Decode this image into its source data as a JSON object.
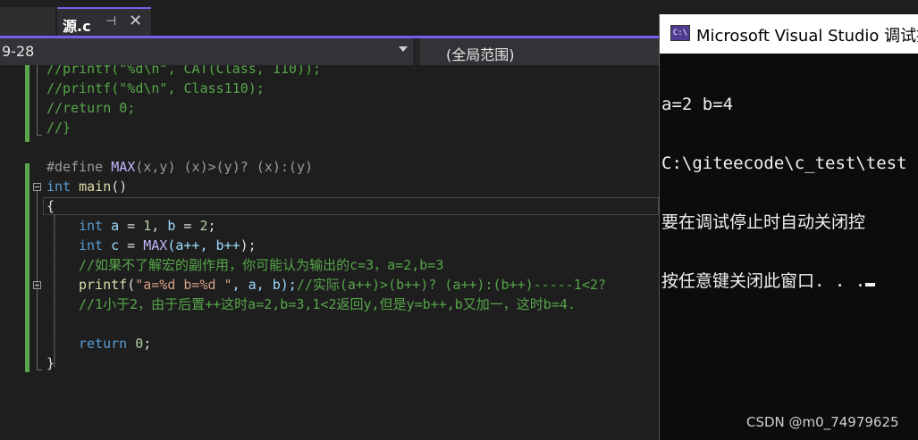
{
  "tab": {
    "title": "源.c",
    "pin": "⊣",
    "close": "✕"
  },
  "nav": {
    "scope_left": "9-28",
    "scope_right": "(全局范围)"
  },
  "code": {
    "l1": "//printf(\"%d\\n\", CAT(Class, 110));",
    "l2": "//printf(\"%d\\n\", Class110);",
    "l3": "//return 0;",
    "l4": "//}",
    "define_kw": "#define",
    "define_name": "MAX",
    "define_params": "(x,y)",
    "define_body": " (x)>(y)? (x):(y)",
    "main_kw": "int",
    "main_name": " main",
    "main_paren": "()",
    "brace_open": "{",
    "a_kw": "int",
    "a_name1": " a",
    "a_eq1": " = ",
    "a_val1": "1",
    "a_sep": ", ",
    "a_name2": "b",
    "a_eq2": " = ",
    "a_val2": "2",
    "a_end": ";",
    "c_kw": "int",
    "c_name": " c",
    "c_eq": " = ",
    "c_macro": "MAX",
    "c_args_a": "(a++, ",
    "c_args_b": "b++",
    "c_end": ");",
    "comment1": "//如果不了解宏的副作用，你可能认为输出的c=3，a=2,b=3",
    "printf_fn": "printf",
    "printf_open": "(",
    "printf_str": "\"a=%d b=%d \"",
    "printf_args": ", a, b);",
    "printf_comment": "//实际(a++)>(b++)? (a++):(b++)-----1<2?",
    "comment2": "//1小于2，由于后置++这时a=2,b=3,1<2返回y,但是y=b++,b又加一，这时b=4.",
    "return_kw": "return",
    "return_val": " 0",
    "return_end": ";",
    "brace_close": "}"
  },
  "console": {
    "icon": "C:\\",
    "title": "Microsoft Visual Studio 调试控",
    "lines": [
      "a=2 b=4",
      "C:\\giteecode\\c_test\\test",
      "要在调试停止时自动关闭控",
      "按任意键关闭此窗口. . ."
    ]
  },
  "watermark": "CSDN @m0_74979625"
}
